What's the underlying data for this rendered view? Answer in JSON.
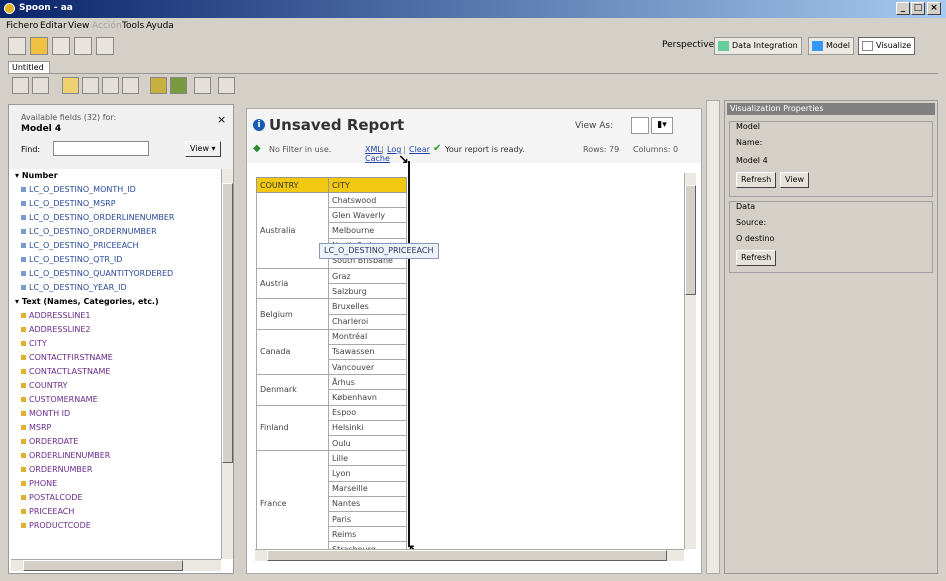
{
  "window": {
    "title": "Spoon - aa"
  },
  "menu": [
    "Fichero",
    "Editar",
    "View",
    "Acción",
    "Tools",
    "Ayuda"
  ],
  "perspective": {
    "label": "Perspective:",
    "buttons": [
      "Data Integration",
      "Model",
      "Visualize"
    ],
    "active": "Visualize"
  },
  "doc_tab": "Untitled",
  "fields_panel": {
    "title": "Available fields (32) for:",
    "model": "Model 4",
    "find_label": "Find:",
    "find_value": "",
    "view_button": "View",
    "close": "×",
    "groups": [
      {
        "name": "Number",
        "fields": [
          "LC_O_DESTINO_MONTH_ID",
          "LC_O_DESTINO_MSRP",
          "LC_O_DESTINO_ORDERLINENUMBER",
          "LC_O_DESTINO_ORDERNUMBER",
          "LC_O_DESTINO_PRICEEACH",
          "LC_O_DESTINO_QTR_ID",
          "LC_O_DESTINO_QUANTITYORDERED",
          "LC_O_DESTINO_YEAR_ID"
        ]
      },
      {
        "name": "Text (Names, Categories, etc.)",
        "fields": [
          "ADDRESSLINE1",
          "ADDRESSLINE2",
          "CITY",
          "CONTACTFIRSTNAME",
          "CONTACTLASTNAME",
          "COUNTRY",
          "CUSTOMERNAME",
          "MONTH ID",
          "MSRP",
          "ORDERDATE",
          "ORDERLINENUMBER",
          "ORDERNUMBER",
          "PHONE",
          "POSTALCODE",
          "PRICEEACH",
          "PRODUCTCODE"
        ]
      }
    ]
  },
  "report": {
    "title": "Unsaved Report",
    "view_as_label": "View As:",
    "filter_text": "No Filter in use.",
    "links": [
      "XML",
      "Log",
      "Clear"
    ],
    "ready_text": "Your report is ready.",
    "rows_label": "Rows: 79",
    "columns_label": "Columns: 0",
    "cache_link": "Cache",
    "columns": [
      "COUNTRY",
      "CITY"
    ],
    "groups": [
      {
        "country": "Australia",
        "cities": [
          "Chatswood",
          "Glen Waverly",
          "Melbourne",
          "North Sydney",
          "South Brisbane"
        ]
      },
      {
        "country": "Austria",
        "cities": [
          "Graz",
          "Salzburg"
        ]
      },
      {
        "country": "Belgium",
        "cities": [
          "Bruxelles",
          "Charleroi"
        ]
      },
      {
        "country": "Canada",
        "cities": [
          "Montréal",
          "Tsawassen",
          "Vancouver"
        ]
      },
      {
        "country": "Denmark",
        "cities": [
          "Århus",
          "København"
        ]
      },
      {
        "country": "Finland",
        "cities": [
          "Espoo",
          "Helsinki",
          "Oulu"
        ]
      },
      {
        "country": "France",
        "cities": [
          "Lille",
          "Lyon",
          "Marseille",
          "Nantes",
          "Paris",
          "Reims",
          "Strasbourg"
        ]
      }
    ],
    "drag_label": "LC_O_DESTINO_PRICEEACH"
  },
  "properties": {
    "title": "Visualization Properties",
    "model_group": "Model",
    "name_label": "Name:",
    "name_value": "Model 4",
    "refresh": "Refresh",
    "view": "View",
    "data_group": "Data",
    "source_label": "Source:",
    "source_value": "O destino",
    "refresh2": "Refresh"
  },
  "colors": {
    "header": "#f2c811",
    "accent": "#0a246a"
  }
}
